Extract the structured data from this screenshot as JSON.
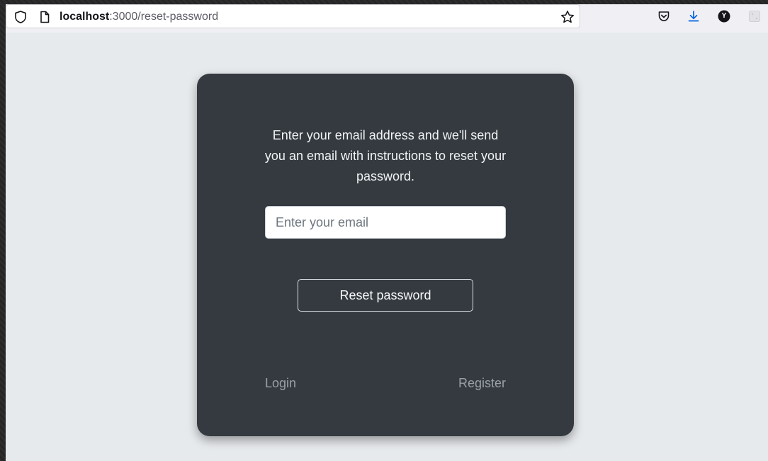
{
  "browser": {
    "url_host": "localhost",
    "url_path": ":3000/reset-password",
    "icons": [
      "shield-icon",
      "page-icon",
      "star-icon",
      "pocket-icon",
      "download-icon",
      "account-avatar-icon",
      "extension-icon"
    ],
    "avatar_letter": "Y",
    "accent": "#0060df"
  },
  "reset_card": {
    "intro_text": "Enter your email address and we'll send you an email with instructions to reset your password.",
    "email_placeholder": "Enter your email",
    "email_value": "",
    "submit_label": "Reset password",
    "login_label": "Login",
    "register_label": "Register",
    "colors": {
      "card_bg": "#343a40",
      "page_bg": "#e7eaed",
      "link": "#99a0a6"
    }
  }
}
